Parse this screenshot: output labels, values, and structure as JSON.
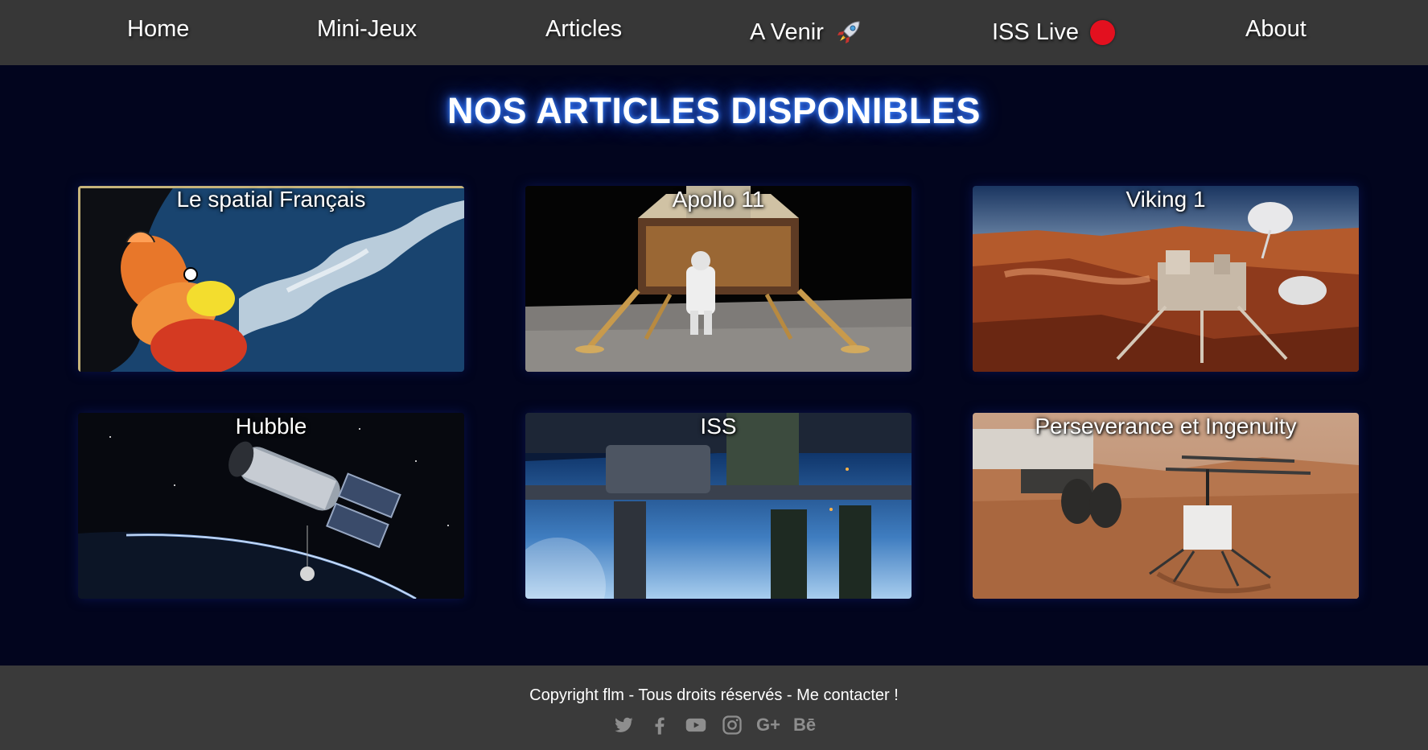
{
  "nav": {
    "home": "Home",
    "minijeux": "Mini-Jeux",
    "articles": "Articles",
    "avenir": "A Venir",
    "isslive": "ISS Live",
    "about": "About",
    "avenir_icon": "rocket-icon",
    "isslive_icon": "red-live-dot",
    "live_color": "#e3101f"
  },
  "page": {
    "title": "NOS ARTICLES DISPONIBLES"
  },
  "articles": [
    {
      "title": "Le spatial Français",
      "image": "asterix-comic-space-image"
    },
    {
      "title": "Apollo 11",
      "image": "lunar-module-astronaut-image"
    },
    {
      "title": "Viking 1",
      "image": "viking-lander-mars-image"
    },
    {
      "title": "Hubble",
      "image": "hubble-telescope-earth-image"
    },
    {
      "title": "ISS",
      "image": "iss-over-earth-image"
    },
    {
      "title": "Perseverance et Ingenuity",
      "image": "ingenuity-helicopter-mars-image"
    }
  ],
  "footer": {
    "copyright": "Copyright flm - Tous droits réservés - Me contacter !",
    "socials": [
      "twitter-icon",
      "facebook-icon",
      "youtube-icon",
      "instagram-icon",
      "google-plus-icon",
      "behance-icon"
    ],
    "gplus_label": "G+",
    "behance_label": "Bē"
  },
  "colors": {
    "nav_bg": "#373737",
    "page_bg": "#02051e",
    "footer_bg": "#3a3a3a",
    "title_glow": "#2f6bff"
  }
}
